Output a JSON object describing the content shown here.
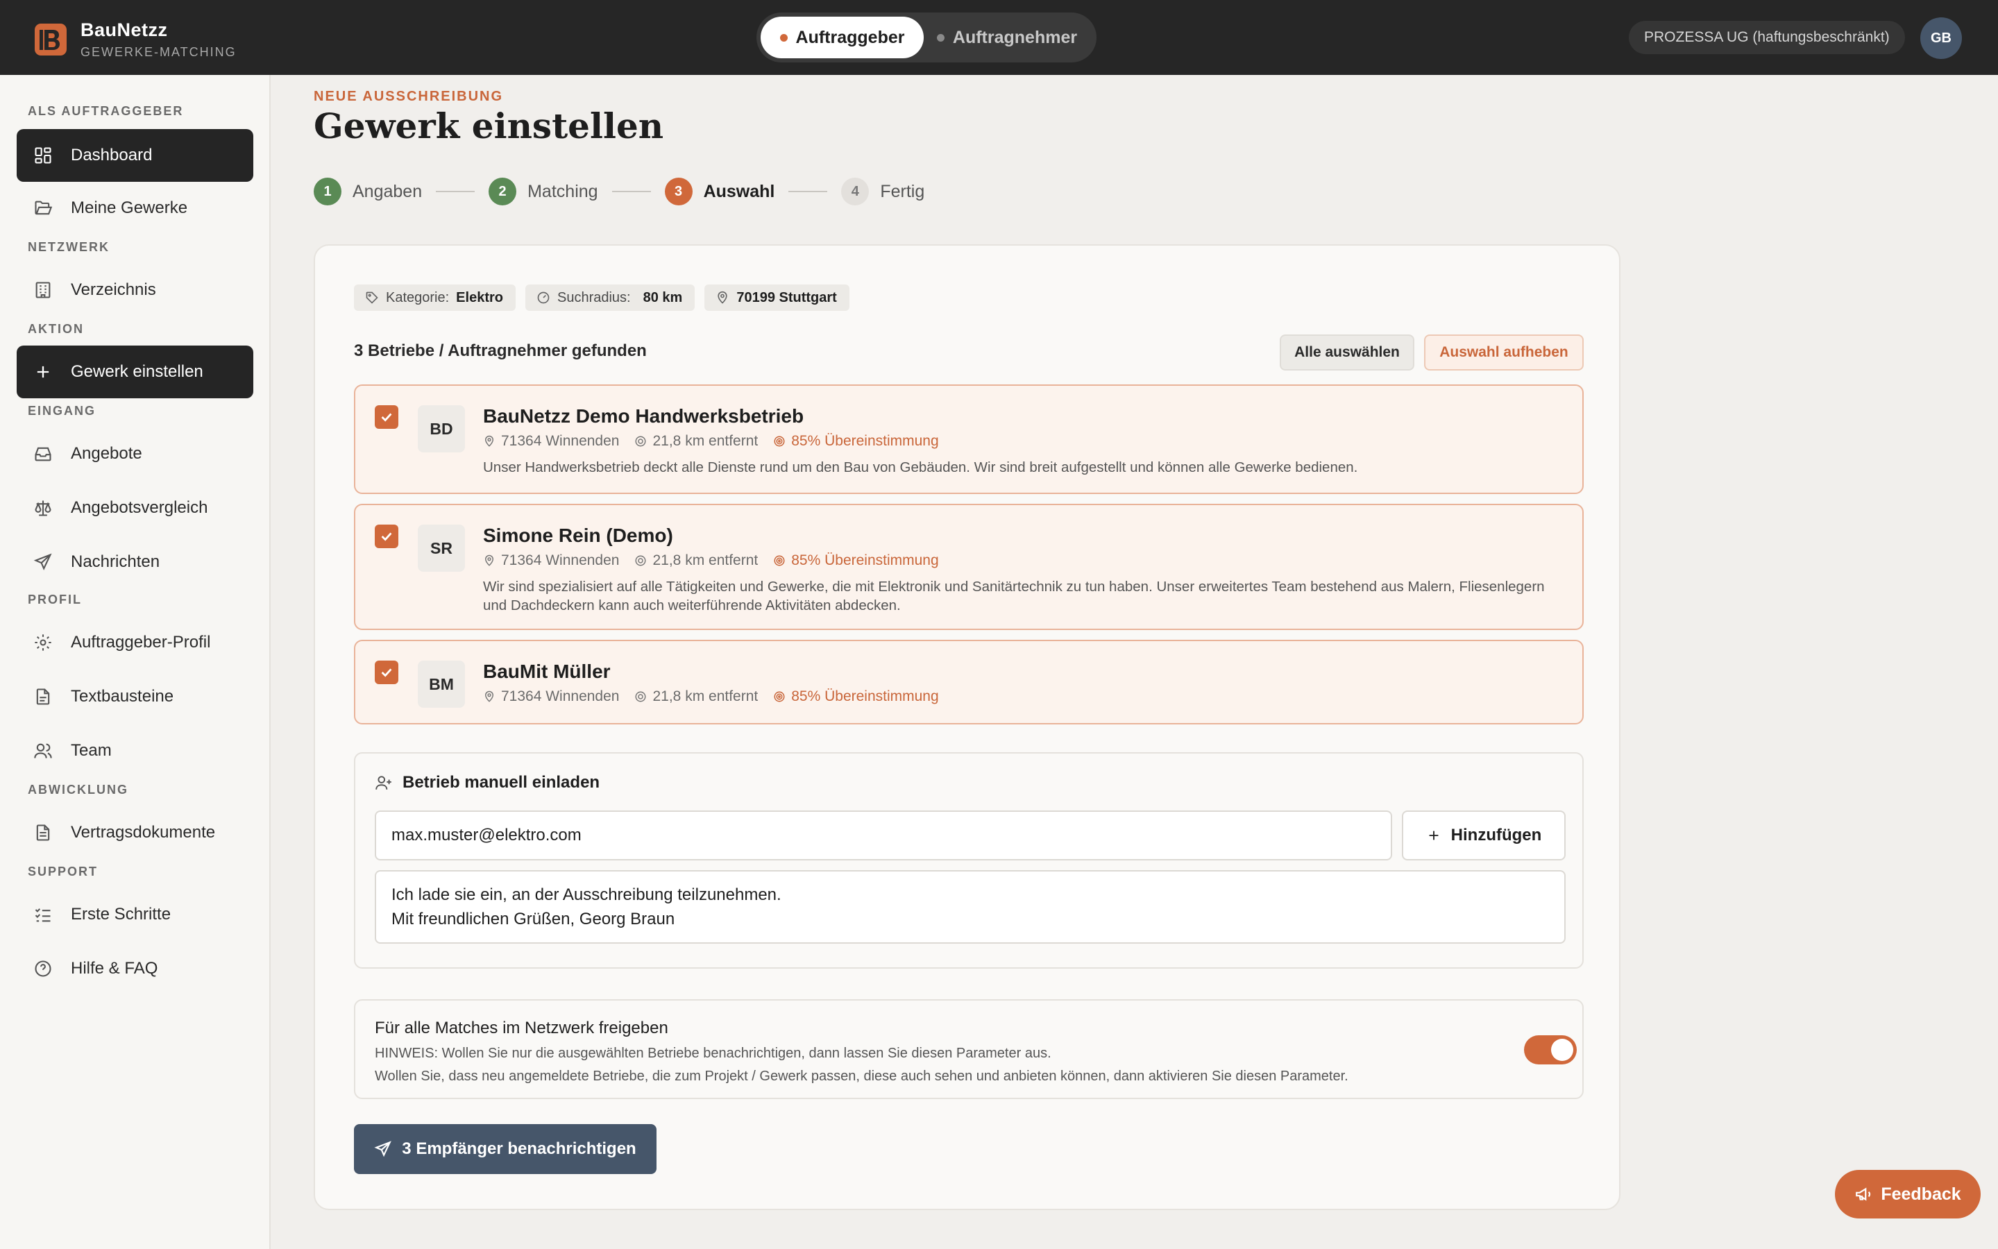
{
  "brand": {
    "name": "BauNetzz",
    "tagline": "GEWERKE-MATCHING"
  },
  "role_toggle": {
    "active": "Auftraggeber",
    "inactive": "Auftragnehmer"
  },
  "header": {
    "company": "PROZESSA UG (haftungsbeschränkt)",
    "avatar_initials": "GB"
  },
  "sidebar": {
    "sections": {
      "auftraggeber": "ALS AUFTRAGGEBER",
      "netzwerk": "NETZWERK",
      "aktion": "AKTION",
      "eingang": "EINGANG",
      "profil": "PROFIL",
      "abwicklung": "ABWICKLUNG",
      "support": "SUPPORT"
    },
    "items": {
      "dashboard": "Dashboard",
      "meine_gewerke": "Meine Gewerke",
      "verzeichnis": "Verzeichnis",
      "gewerk_einstellen": "Gewerk einstellen",
      "angebote": "Angebote",
      "angebotsvergleich": "Angebotsvergleich",
      "nachrichten": "Nachrichten",
      "auftraggeber_profil": "Auftraggeber-Profil",
      "textbausteine": "Textbausteine",
      "team": "Team",
      "vertragsdokumente": "Vertragsdokumente",
      "erste_schritte": "Erste Schritte",
      "hilfe": "Hilfe & FAQ"
    }
  },
  "page": {
    "eyebrow": "NEUE AUSSCHREIBUNG",
    "title": "Gewerk einstellen"
  },
  "steps": [
    {
      "num": "1",
      "label": "Angaben",
      "state": "done"
    },
    {
      "num": "2",
      "label": "Matching",
      "state": "done"
    },
    {
      "num": "3",
      "label": "Auswahl",
      "state": "current"
    },
    {
      "num": "4",
      "label": "Fertig",
      "state": "upcoming"
    }
  ],
  "filters": {
    "kategorie_label": "Kategorie:",
    "kategorie_value": "Elektro",
    "radius_label": "Suchradius:",
    "radius_value": "80 km",
    "location": "70199 Stuttgart"
  },
  "results": {
    "count_text": "3 Betriebe / Auftragnehmer gefunden",
    "select_all": "Alle auswählen",
    "clear_selection": "Auswahl aufheben",
    "companies": [
      {
        "initials": "BD",
        "name": "BauNetzz Demo Handwerksbetrieb",
        "location": "71364 Winnenden",
        "distance": "21,8 km entfernt",
        "match": "85% Übereinstimmung",
        "description": "Unser Handwerksbetrieb deckt alle Dienste rund um den Bau von Gebäuden. Wir sind breit aufgestellt und können alle Gewerke bedienen.",
        "checked": true
      },
      {
        "initials": "SR",
        "name": "Simone Rein (Demo)",
        "location": "71364 Winnenden",
        "distance": "21,8 km entfernt",
        "match": "85% Übereinstimmung",
        "description": "Wir sind spezialisiert auf alle Tätigkeiten und Gewerke, die mit Elektronik und Sanitärtechnik zu tun haben. Unser erweitertes Team bestehend aus Malern, Fliesenlegern und Dachdeckern kann auch weiterführende Aktivitäten abdecken.",
        "checked": true
      },
      {
        "initials": "BM",
        "name": "BauMit Müller",
        "location": "71364 Winnenden",
        "distance": "21,8 km entfernt",
        "match": "85% Übereinstimmung",
        "description": "",
        "checked": true
      }
    ]
  },
  "invite": {
    "title": "Betrieb manuell einladen",
    "email_value": "max.muster@elektro.com",
    "add_label": "Hinzufügen",
    "message": "Ich lade sie ein, an der Ausschreibung teilzunehmen.\nMit freundlichen Grüßen, Georg Braun"
  },
  "share": {
    "title": "Für alle Matches im Netzwerk freigeben",
    "note_1": "HINWEIS: Wollen Sie nur die ausgewählten Betriebe benachrichtigen, dann lassen Sie diesen Parameter aus.",
    "note_2": "Wollen Sie, dass neu angemeldete Betriebe, die zum Projekt / Gewerk passen, diese auch sehen und anbieten können, dann aktivieren Sie diesen Parameter.",
    "enabled": true
  },
  "send_button": "3 Empfänger benachrichtigen",
  "feedback_button": "Feedback",
  "colors": {
    "accent": "#d0683a",
    "dark": "#252525",
    "slate": "#46566a",
    "done_green": "#5a8a55"
  }
}
